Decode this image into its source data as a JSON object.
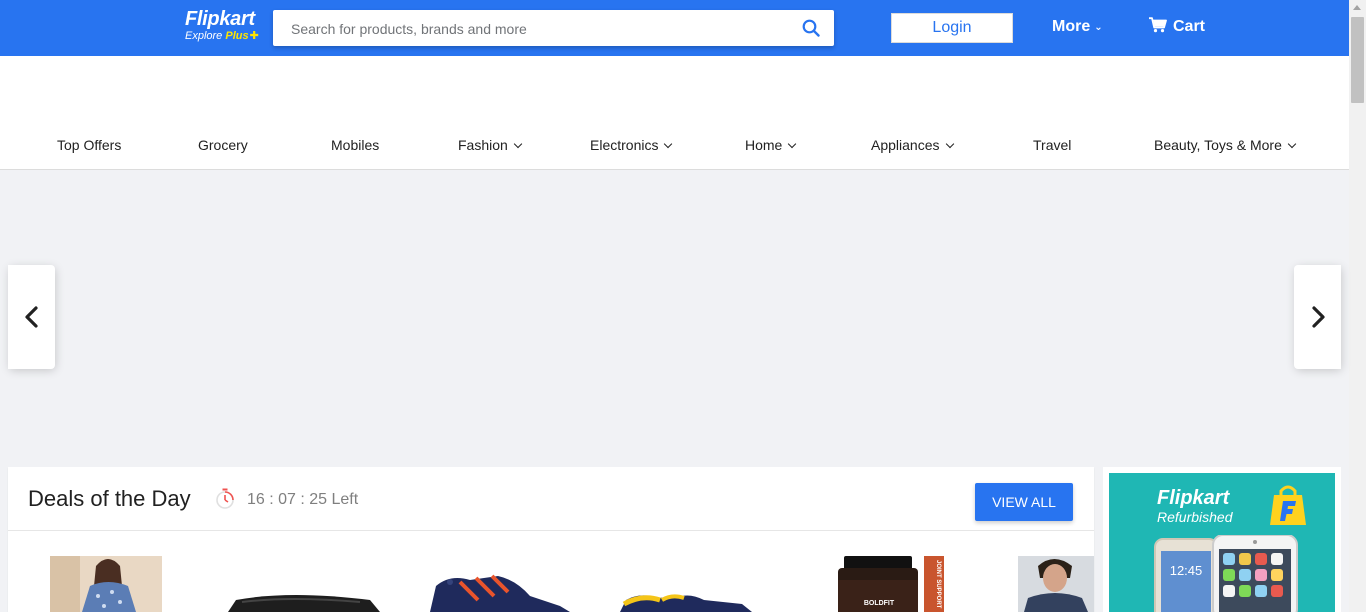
{
  "header": {
    "logo": {
      "name": "Flipkart",
      "sub_explore": "Explore",
      "sub_plus": "Plus"
    },
    "search": {
      "placeholder": "Search for products, brands and more",
      "value": ""
    },
    "login_label": "Login",
    "more_label": "More",
    "cart_label": "Cart"
  },
  "nav": {
    "items": [
      {
        "label": "Top Offers",
        "has_dropdown": false
      },
      {
        "label": "Grocery",
        "has_dropdown": false
      },
      {
        "label": "Mobiles",
        "has_dropdown": false
      },
      {
        "label": "Fashion",
        "has_dropdown": true
      },
      {
        "label": "Electronics",
        "has_dropdown": true
      },
      {
        "label": "Home",
        "has_dropdown": true
      },
      {
        "label": "Appliances",
        "has_dropdown": true
      },
      {
        "label": "Travel",
        "has_dropdown": false
      },
      {
        "label": "Beauty, Toys & More",
        "has_dropdown": true
      }
    ]
  },
  "deals": {
    "title": "Deals of the Day",
    "timer": "16 : 07 : 25 Left",
    "view_all_label": "VIEW ALL",
    "products": [
      {
        "image": "dress-model"
      },
      {
        "image": "black-gadget"
      },
      {
        "image": "navy-sneaker-orange"
      },
      {
        "image": "yellow-navy-sneaker"
      },
      {
        "image": "supplement-jar",
        "brand_mark": "BOLDFIT",
        "side_text": "JOINT SUPPORT"
      },
      {
        "image": "tshirt-model"
      }
    ]
  },
  "promo": {
    "brand": "Flipkart",
    "tagline": "Refurbished",
    "phone_time": "12:45"
  },
  "colors": {
    "brand_blue": "#2874f0",
    "brand_yellow": "#ffe500",
    "page_bg": "#f1f2f5",
    "promo_teal": "#1fb7b4"
  }
}
